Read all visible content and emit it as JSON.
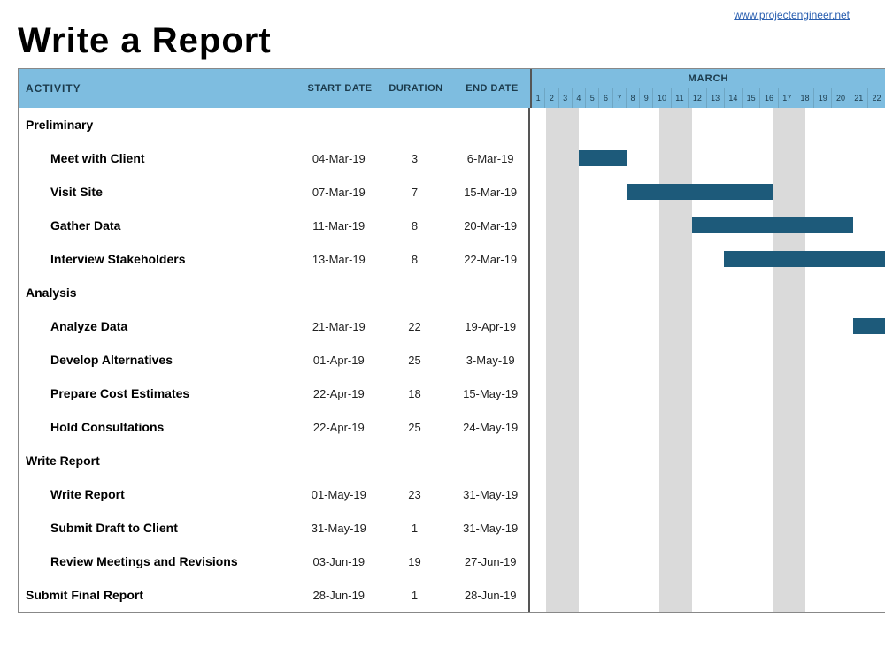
{
  "link": {
    "label": "www.projectengineer.net"
  },
  "title": "Write a Report",
  "headers": {
    "activity": "ACTIVITY",
    "start": "START DATE",
    "duration": "DURATION",
    "end": "END DATE",
    "month": "MARCH"
  },
  "timeline": {
    "days_visible": 22,
    "weekend_pairs": [
      [
        2,
        3
      ],
      [
        9,
        10
      ],
      [
        16,
        17
      ]
    ],
    "day_labels": [
      "1",
      "2",
      "3",
      "4",
      "5",
      "6",
      "7",
      "8",
      "9",
      "10",
      "11",
      "12",
      "13",
      "14",
      "15",
      "16",
      "17",
      "18",
      "19",
      "20",
      "21",
      "22"
    ]
  },
  "rows": [
    {
      "type": "group",
      "activity": "Preliminary"
    },
    {
      "type": "task",
      "activity": "Meet with Client",
      "start": "04-Mar-19",
      "duration": "3",
      "end": "6-Mar-19",
      "bar_start": 4,
      "bar_end": 6
    },
    {
      "type": "task",
      "activity": "Visit Site",
      "start": "07-Mar-19",
      "duration": "7",
      "end": "15-Mar-19",
      "bar_start": 7,
      "bar_end": 15
    },
    {
      "type": "task",
      "activity": "Gather Data",
      "start": "11-Mar-19",
      "duration": "8",
      "end": "20-Mar-19",
      "bar_start": 11,
      "bar_end": 20
    },
    {
      "type": "task",
      "activity": "Interview Stakeholders",
      "start": "13-Mar-19",
      "duration": "8",
      "end": "22-Mar-19",
      "bar_start": 13,
      "bar_end": 22
    },
    {
      "type": "group",
      "activity": "Analysis"
    },
    {
      "type": "task",
      "activity": "Analyze Data",
      "start": "21-Mar-19",
      "duration": "22",
      "end": "19-Apr-19",
      "bar_start": 21,
      "bar_end": 22
    },
    {
      "type": "task",
      "activity": "Develop Alternatives",
      "start": "01-Apr-19",
      "duration": "25",
      "end": "3-May-19"
    },
    {
      "type": "task",
      "activity": "Prepare Cost Estimates",
      "start": "22-Apr-19",
      "duration": "18",
      "end": "15-May-19"
    },
    {
      "type": "task",
      "activity": "Hold Consultations",
      "start": "22-Apr-19",
      "duration": "25",
      "end": "24-May-19"
    },
    {
      "type": "group",
      "activity": "Write Report"
    },
    {
      "type": "task",
      "activity": "Write Report",
      "start": "01-May-19",
      "duration": "23",
      "end": "31-May-19"
    },
    {
      "type": "task",
      "activity": "Submit Draft to Client",
      "start": "31-May-19",
      "duration": "1",
      "end": "31-May-19"
    },
    {
      "type": "task",
      "activity": "Review Meetings and Revisions",
      "start": "03-Jun-19",
      "duration": "19",
      "end": "27-Jun-19"
    },
    {
      "type": "group-task",
      "activity": "Submit Final Report",
      "start": "28-Jun-19",
      "duration": "1",
      "end": "28-Jun-19"
    }
  ],
  "chart_data": {
    "type": "bar",
    "title": "Write a Report",
    "xlabel": "MARCH",
    "ylabel": "ACTIVITY",
    "x_days_visible": [
      1,
      22
    ],
    "tasks": [
      {
        "name": "Meet with Client",
        "start": "04-Mar-19",
        "end": "06-Mar-19",
        "duration_days": 3
      },
      {
        "name": "Visit Site",
        "start": "07-Mar-19",
        "end": "15-Mar-19",
        "duration_days": 7
      },
      {
        "name": "Gather Data",
        "start": "11-Mar-19",
        "end": "20-Mar-19",
        "duration_days": 8
      },
      {
        "name": "Interview Stakeholders",
        "start": "13-Mar-19",
        "end": "22-Mar-19",
        "duration_days": 8
      },
      {
        "name": "Analyze Data",
        "start": "21-Mar-19",
        "end": "19-Apr-19",
        "duration_days": 22
      },
      {
        "name": "Develop Alternatives",
        "start": "01-Apr-19",
        "end": "03-May-19",
        "duration_days": 25
      },
      {
        "name": "Prepare Cost Estimates",
        "start": "22-Apr-19",
        "end": "15-May-19",
        "duration_days": 18
      },
      {
        "name": "Hold Consultations",
        "start": "22-Apr-19",
        "end": "24-May-19",
        "duration_days": 25
      },
      {
        "name": "Write Report",
        "start": "01-May-19",
        "end": "31-May-19",
        "duration_days": 23
      },
      {
        "name": "Submit Draft to Client",
        "start": "31-May-19",
        "end": "31-May-19",
        "duration_days": 1
      },
      {
        "name": "Review Meetings and Revisions",
        "start": "03-Jun-19",
        "end": "27-Jun-19",
        "duration_days": 19
      },
      {
        "name": "Submit Final Report",
        "start": "28-Jun-19",
        "end": "28-Jun-19",
        "duration_days": 1
      }
    ],
    "groups": [
      "Preliminary",
      "Analysis",
      "Write Report"
    ]
  }
}
